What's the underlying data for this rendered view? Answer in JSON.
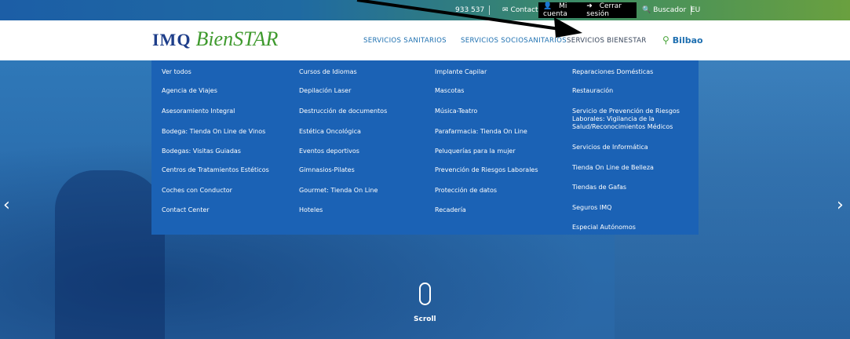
{
  "topbar": {
    "phone": "933 537",
    "contact": "Contacto",
    "my_account": "Mi cuenta",
    "logout": "Cerrar sesión",
    "search": "Buscador",
    "lang": "EU"
  },
  "header": {
    "logo_text": "IMQ",
    "logo_script": "BienSTAR",
    "nav": [
      "SERVICIOS SANITARIOS",
      "SERVICIOS SOCIOSANITARIOS",
      "SERVICIOS BIENESTAR"
    ],
    "city": "Bilbao"
  },
  "menu": {
    "col1": [
      "Ver todos",
      "Agencia de Viajes",
      "Asesoramiento Integral",
      "Bodega: Tienda On Line de Vinos",
      "Bodegas: Visitas Guiadas",
      "Centros de Tratamientos Estéticos",
      "Coches con Conductor",
      "Contact Center"
    ],
    "col2": [
      "Cursos de Idiomas",
      "Depilación Laser",
      "Destrucción de documentos",
      "Estética Oncológica",
      "Eventos deportivos",
      "Gimnasios-Pilates",
      "Gourmet: Tienda On Line",
      "Hoteles"
    ],
    "col3": [
      "Implante Capilar",
      "Mascotas",
      "Música-Teatro",
      "Parafarmacia: Tienda On Line",
      "Peluquerías para la mujer",
      "Prevención de Riesgos Laborales",
      "Protección de datos",
      "Recadería"
    ],
    "col4": [
      "Reparaciones Domésticas",
      "Restauración",
      "Servicio de Prevención de Riesgos Laborales: Vigilancia de la Salud/Reconocimientos Médicos",
      "Servicios de Informática",
      "Tienda On Line de Belleza",
      "Tiendas de Gafas",
      "Seguros IMQ",
      "Especial Autónomos"
    ]
  },
  "hero": {
    "scroll_label": "Scroll"
  },
  "colors": {
    "menu_bg": "#1b62b5",
    "nav_blue": "#1c6fb0",
    "logo_green": "#3f9a2e"
  }
}
